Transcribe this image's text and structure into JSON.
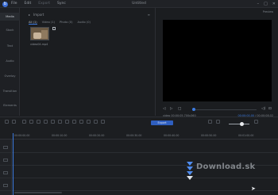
{
  "titlebar": {
    "menu": [
      "File",
      "Edit",
      "Export",
      "Sync"
    ],
    "title": "Untitled",
    "controls": [
      "–",
      "□",
      "✕"
    ]
  },
  "sidebar": {
    "items": [
      "Media",
      "Stock",
      "Text",
      "Audio",
      "Overlay",
      "Transition",
      "Elements"
    ]
  },
  "media": {
    "header": "Import",
    "tabs": [
      "All (1)",
      "Video (1)",
      "Photo (0)",
      "Audio (0)"
    ],
    "clip_label": "video04.mp4"
  },
  "preview": {
    "label": "Preview",
    "time_current": "00:00:00.00",
    "time_total": "00:00:08.02",
    "info": "video 00:00:05,700x360",
    "buttons": [
      "◁",
      "▷",
      "□",
      "⊡"
    ]
  },
  "timeline": {
    "export_label": "Export",
    "ruler": [
      "00:00:00.00",
      "00:00:10.00",
      "00:00:20.00",
      "00:00:30.00",
      "00:00:40.00",
      "00:00:50.00",
      "00:01:00.00"
    ]
  },
  "watermark": "Download.sk",
  "colors": {
    "accent": "#3d7be0",
    "background": "#1b1c1f"
  }
}
